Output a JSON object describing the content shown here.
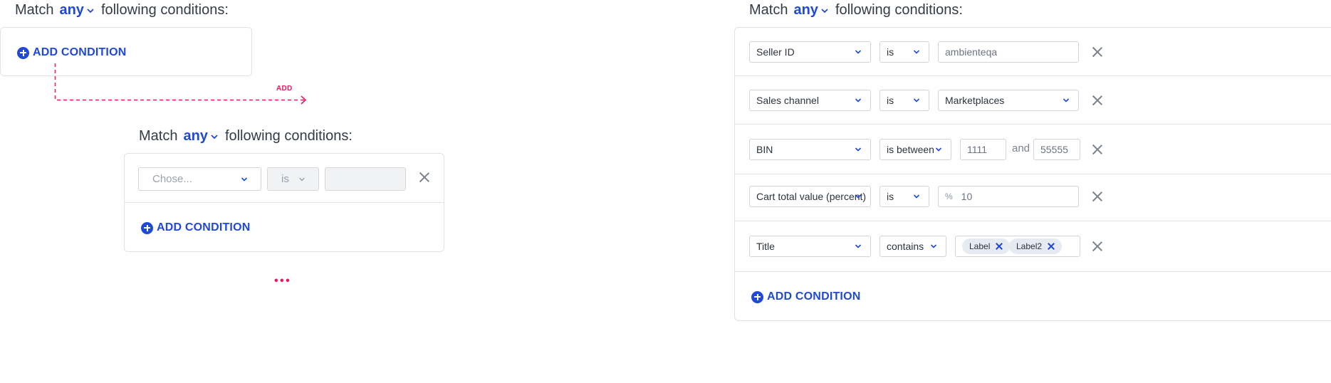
{
  "match": {
    "prefix": "Match",
    "mode": "any",
    "suffix": "following conditions:"
  },
  "add_condition_label": "ADD CONDITION",
  "flow": {
    "arrow_label": "ADD",
    "more": "• • •"
  },
  "step1": {},
  "step2": {
    "field": {
      "placeholder": "Chose..."
    },
    "operator": {
      "value": "is"
    },
    "value": {
      "value": ""
    }
  },
  "result": {
    "rows": [
      {
        "field": "Seller ID",
        "operator": "is",
        "value": "ambienteqa"
      },
      {
        "field": "Sales channel",
        "operator": "is",
        "value": "Marketplaces"
      },
      {
        "field": "BIN",
        "operator": "is between",
        "value_from": "1111",
        "and_label": "and",
        "value_to": "55555"
      },
      {
        "field": "Cart total value (percent)",
        "operator": "is",
        "prefix": "%",
        "value": "10"
      },
      {
        "field": "Title",
        "operator": "contains",
        "tags": [
          "Label",
          "Label2"
        ]
      }
    ]
  },
  "colors": {
    "accent": "#1f49d6",
    "flow_pink": "#e8195c",
    "border": "#dfe2e7",
    "disabled_bg": "#f1f2f4"
  },
  "icons": [
    "plus-circle-icon",
    "chevron-down-icon",
    "close-icon",
    "dashed-arrow-icon"
  ]
}
